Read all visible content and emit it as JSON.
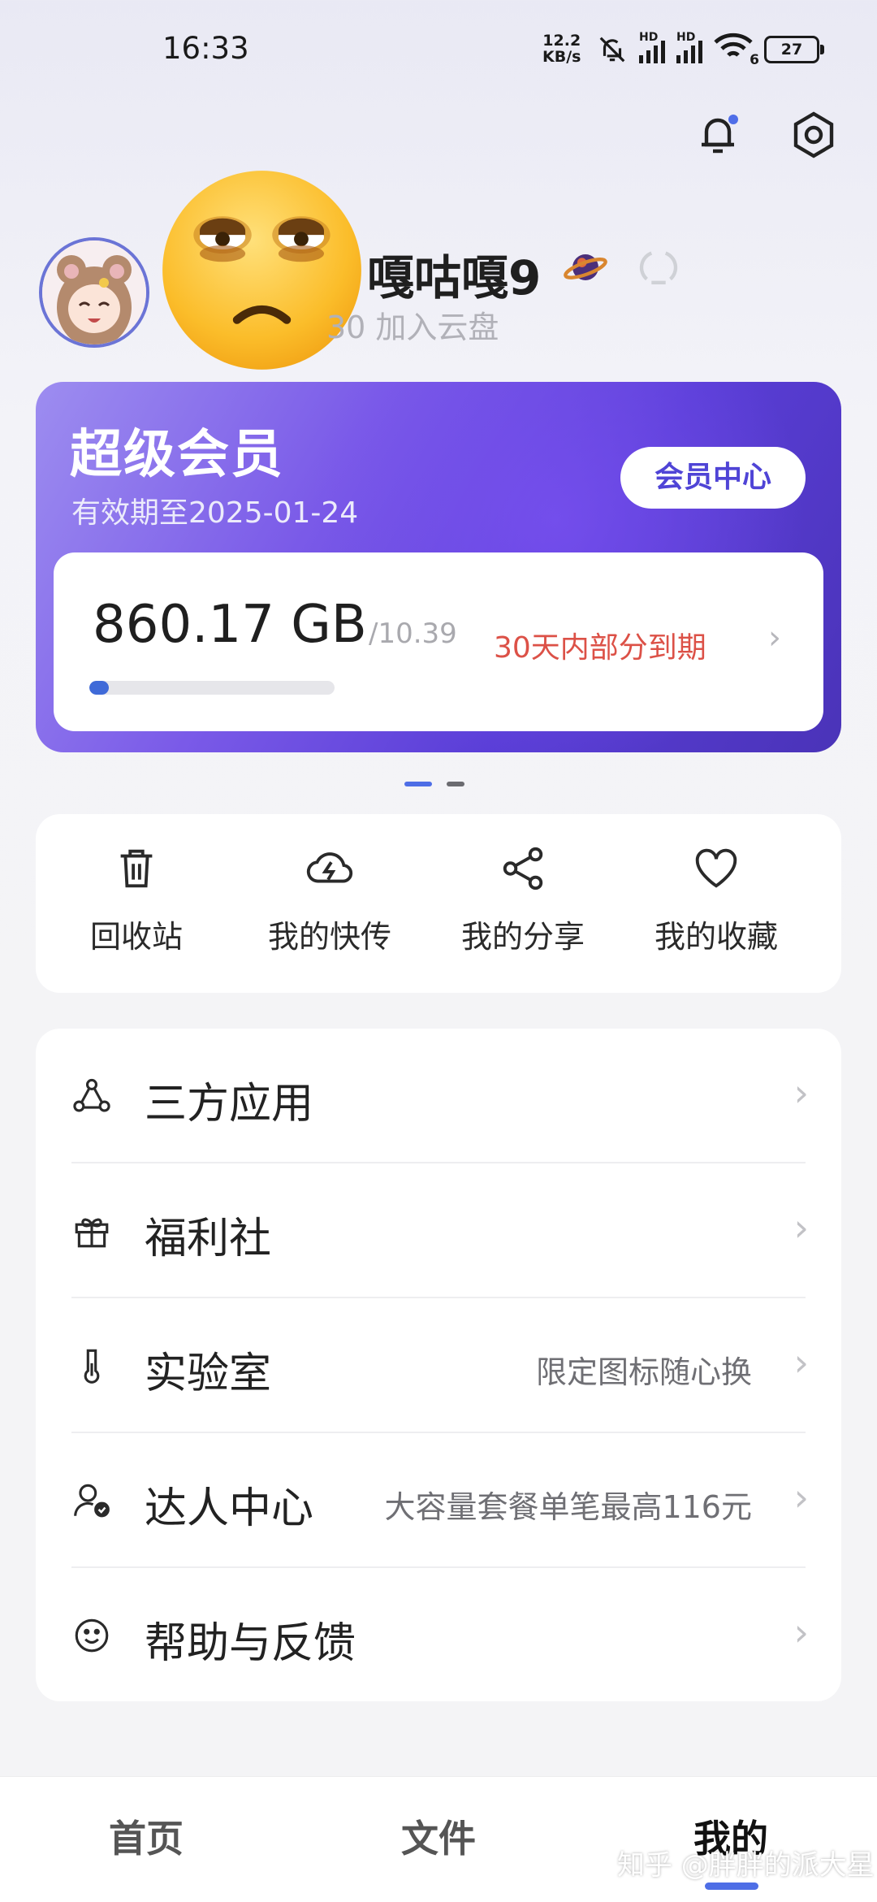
{
  "status_bar": {
    "time": "16:33",
    "net_speed_value": "12.2",
    "net_speed_unit": "KB/s",
    "hd_label": "HD",
    "wifi_label": "6",
    "battery": "27"
  },
  "profile": {
    "username": "嘎咕嘎9",
    "join_text": "30 加入云盘"
  },
  "vip": {
    "title": "超级会员",
    "expire": "有效期至2025-01-24",
    "center_button": "会员中心",
    "storage_used": "860.17 GB",
    "storage_total": "/10.39",
    "storage_fraction": 0.08,
    "expire_note": "30天内部分到期",
    "colors": {
      "accent": "#5a3ed7",
      "bar": "#3f6ad8",
      "warning": "#dc5147"
    }
  },
  "quick_actions": [
    {
      "label": "回收站",
      "icon": "trash-icon"
    },
    {
      "label": "我的快传",
      "icon": "cloud-lightning-icon"
    },
    {
      "label": "我的分享",
      "icon": "share-icon"
    },
    {
      "label": "我的收藏",
      "icon": "heart-icon"
    }
  ],
  "menu": [
    {
      "title": "三方应用",
      "subtitle": "",
      "icon": "apps-triangle-icon"
    },
    {
      "title": "福利社",
      "subtitle": "",
      "icon": "gift-icon"
    },
    {
      "title": "实验室",
      "subtitle": "限定图标随心换",
      "icon": "thermometer-icon"
    },
    {
      "title": "达人中心",
      "subtitle": "大容量套餐单笔最高116元",
      "icon": "user-badge-icon"
    },
    {
      "title": "帮助与反馈",
      "subtitle": "",
      "icon": "smile-icon"
    }
  ],
  "bottom_nav": [
    {
      "label": "首页",
      "active": false
    },
    {
      "label": "文件",
      "active": false
    },
    {
      "label": "我的",
      "active": true
    }
  ],
  "watermark": "知乎 @胖胖的派大星"
}
